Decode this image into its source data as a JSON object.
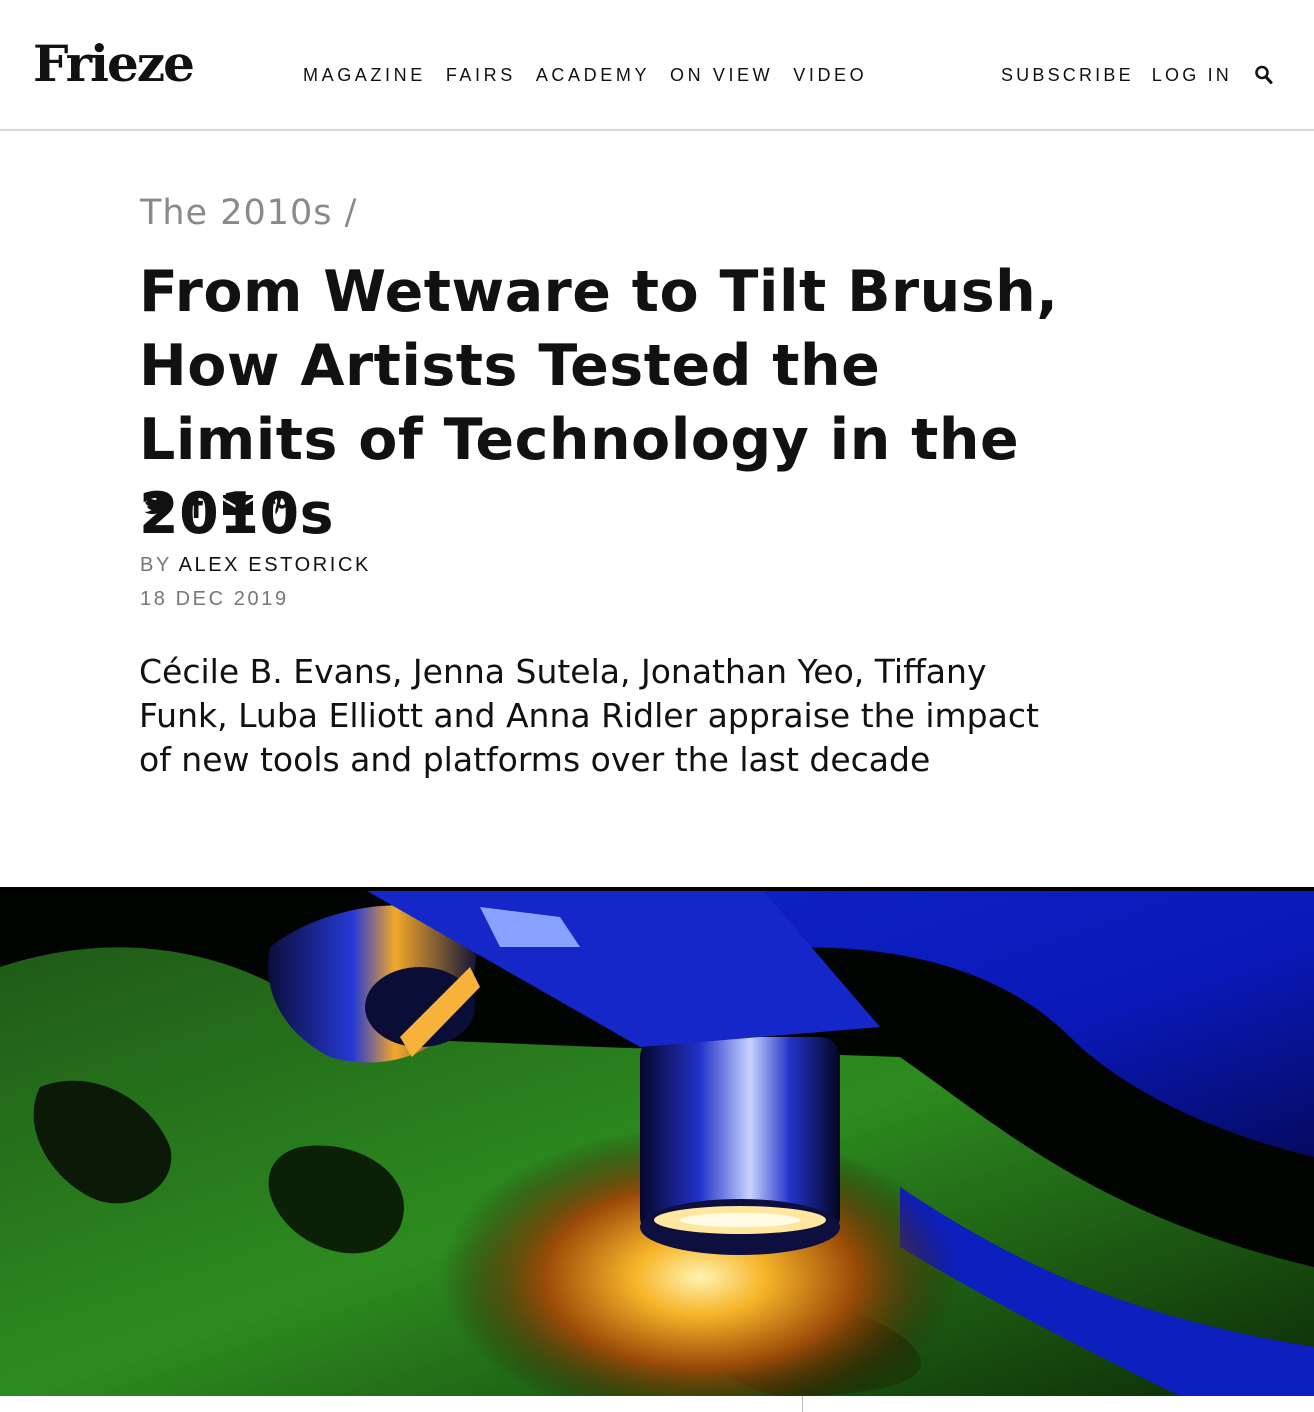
{
  "header": {
    "logo": "Frieze",
    "nav": [
      "MAGAZINE",
      "FAIRS",
      "ACADEMY",
      "ON VIEW",
      "VIDEO"
    ],
    "subscribe": "SUBSCRIBE",
    "login": "LOG IN",
    "search_icon": "search-icon"
  },
  "article": {
    "breadcrumb": "The 2010s",
    "breadcrumb_separator": " /",
    "title": "From Wetware to Tilt Brush, How Artists Tested the Limits of Technology in the 2010s",
    "share_icons": [
      "twitter-icon",
      "facebook-icon",
      "email-icon",
      "pinterest-icon"
    ],
    "byline_prefix": "BY ",
    "author": "ALEX ESTORICK",
    "date": "18 DEC 2019",
    "standfirst": "Cécile B. Evans, Jenna Sutela, Jonathan Yeo, Tiffany Funk, Luba Elliott and Anna Ridler appraise the impact of new tools and platforms over the last decade"
  },
  "colors": {
    "text": "#111111",
    "muted": "#8a8a8a",
    "divider": "#d8d8d8"
  }
}
